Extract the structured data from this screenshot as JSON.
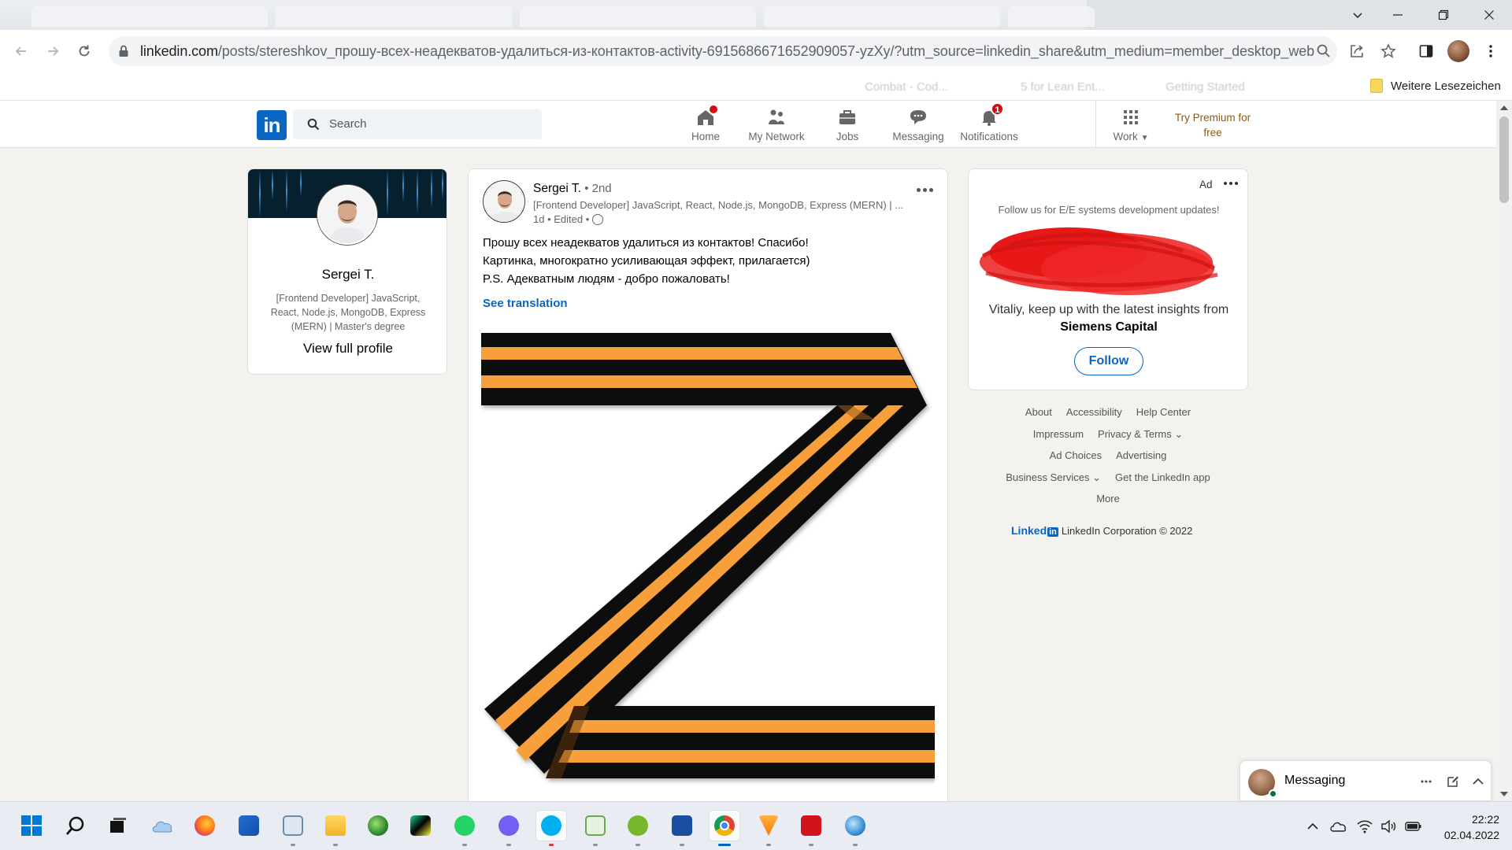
{
  "browser": {
    "url_host": "linkedin.com",
    "url_path": "/posts/stereshkov_прошу-всех-неадекватов-удалиться-из-контактов-activity-6915686671652909057-yzXy/?utm_source=linkedin_share&utm_medium=member_desktop_web",
    "bookmark_folder_label": "Weitere Lesezeichen",
    "faded_bookmarks": [
      "Combat - Cod...",
      "5 for Lean Ent...",
      "Getting Started"
    ]
  },
  "linkedin_header": {
    "logo": "in",
    "search_placeholder": "Search",
    "nav": [
      {
        "label": "Home",
        "icon": "home-icon",
        "badge": ""
      },
      {
        "label": "My Network",
        "icon": "network-icon",
        "badge": ""
      },
      {
        "label": "Jobs",
        "icon": "jobs-icon",
        "badge": ""
      },
      {
        "label": "Messaging",
        "icon": "messaging-icon",
        "badge": ""
      },
      {
        "label": "Notifications",
        "icon": "bell-icon",
        "badge": "1"
      }
    ],
    "work_label": "Work",
    "premium_label": "Try Premium for free"
  },
  "profile_card": {
    "name": "Sergei T.",
    "headline": "[Frontend Developer] JavaScript, React, Node.js, MongoDB, Express (MERN) | Master's degree",
    "view_profile": "View full profile"
  },
  "post": {
    "author": "Sergei T.",
    "degree": "• 2nd",
    "headline": "[Frontend Developer] JavaScript, React, Node.js, MongoDB, Express (MERN) | ...",
    "meta": "1d • Edited •",
    "lines": [
      "Прошу всех неадекватов удалиться из контактов! Спасибо!",
      "Картинка, многократно усиливающая эффект, прилагается)",
      "P.S. Адекватным людям - добро пожаловать!"
    ],
    "translate_label": "See translation"
  },
  "ad": {
    "label": "Ad",
    "subtitle": "Follow us for E/E systems development updates!",
    "body_prefix": "Vitaliy, keep up with the latest insights from",
    "company": "Siemens Capital",
    "follow_label": "Follow"
  },
  "footer": {
    "row1": [
      "About",
      "Accessibility",
      "Help Center"
    ],
    "row2_a": "Impressum",
    "row2_b": "Privacy & Terms",
    "row3": [
      "Ad Choices",
      "Advertising"
    ],
    "row4_a": "Business Services",
    "row4_b": "Get the LinkedIn app",
    "row5": "More",
    "brand_word": "Linked",
    "brand_box": "in",
    "copyright": "LinkedIn Corporation © 2022"
  },
  "messaging": {
    "title": "Messaging"
  },
  "taskbar": {
    "time": "22:22",
    "date": "02.04.2022"
  },
  "colors": {
    "linkedin_blue": "#0a66c2",
    "ribbon_orange": "#f7a03a",
    "ribbon_black": "#0a0a0a",
    "badge_red": "#cc1016"
  }
}
